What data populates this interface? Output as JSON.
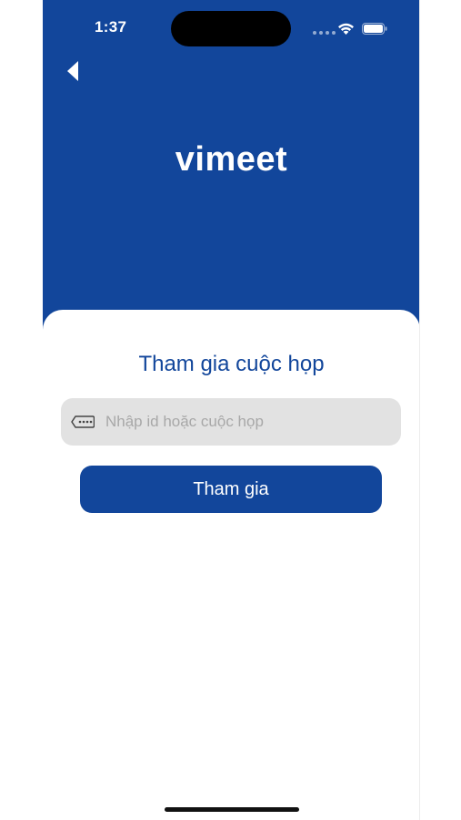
{
  "status_bar": {
    "time": "1:37",
    "wifi_icon": "wifi-icon",
    "battery_icon": "battery-icon"
  },
  "header": {
    "back_icon": "chevron-left-icon",
    "logo_text": "vimeet",
    "background_color": "#12469b"
  },
  "join_card": {
    "title": "Tham gia cuộc họp",
    "input": {
      "value": "",
      "placeholder": "Nhập id hoặc cuộc họp",
      "icon": "password-field-icon"
    },
    "join_button_label": "Tham gia"
  },
  "colors": {
    "primary": "#12469b",
    "input_background": "#e2e2e2",
    "placeholder": "#a8a8a8"
  }
}
